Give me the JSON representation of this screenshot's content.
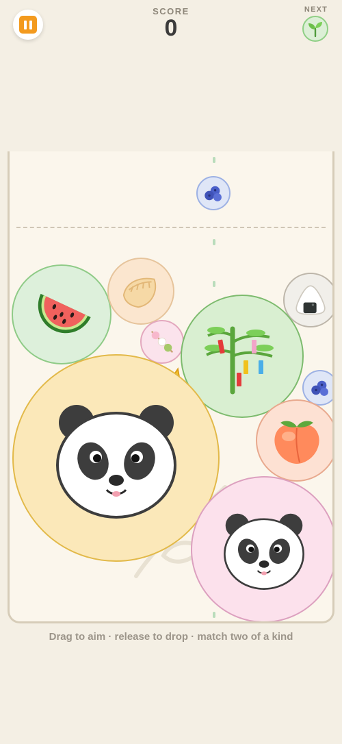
{
  "header": {
    "score_label": "SCORE",
    "score_value": "0",
    "next_label": "NEXT",
    "next_item": "seedling-icon",
    "pause_icon": "pause-icon"
  },
  "board": {
    "hint": "Drag to aim · release to drop · match two of a kind",
    "pieces": [
      "blueberries",
      "dumpling",
      "watermelon",
      "rice-ball",
      "dango",
      "tanabata-tree",
      "crown",
      "blueberries",
      "peach",
      "panda",
      "panda"
    ]
  },
  "colors": {
    "background": "#f4efe4",
    "board": "#fbf6ec",
    "accent": "#f39a1e",
    "aim": "#b9dcbb"
  }
}
